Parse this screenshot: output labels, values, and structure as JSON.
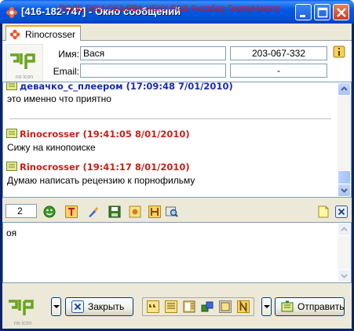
{
  "window": {
    "title": "[416-182-747] - Окно сообщений",
    "title_overlay": "ПОЛЕ ПОИ ОБЪЯВА НЕКУ РОВ Рисабер ТеопмНикогр",
    "icon": "qip-flower-icon",
    "controls": [
      "minimize-icon",
      "maximize-icon",
      "close-icon"
    ]
  },
  "tab": {
    "label": "Rinocrosser",
    "icon": "flower-icon"
  },
  "contact": {
    "name_label": "Имя:",
    "name_value": "Вася",
    "uin_value": "203-067-332",
    "email_label": "Email:",
    "email_value": "",
    "extra_value": "-",
    "logo_caption": "no icon"
  },
  "history": {
    "messages": [
      {
        "author": "девачко_с_плеером",
        "time": "(17:09:48 7/01/2010)",
        "text": "это именно что приятно",
        "color": "#1a2ab0"
      },
      {
        "author": "Rinocrosser",
        "time": "(19:41:05 8/01/2010)",
        "text": "Сижу на кинопоиске",
        "color": "#c8201a"
      },
      {
        "author": "Rinocrosser",
        "time": "(19:41:17 8/01/2010)",
        "text": "Думаю написать рецензию к порнофильму",
        "color": "#c8201a"
      }
    ]
  },
  "format_toolbar": {
    "counter": "2",
    "icons": [
      "smiley-icon",
      "text-format-icon",
      "color-brush-icon",
      "save-icon",
      "image-icon",
      "history-icon",
      "search-icon",
      "note-icon",
      "close-tab-icon"
    ]
  },
  "input": {
    "text": "оя"
  },
  "bottom": {
    "logo_caption": "no icon",
    "close_label": "Закрыть",
    "send_label": "Отправить",
    "strip_icons": [
      "quote-icon",
      "notes-icon",
      "contacts-icon",
      "transfer-icon",
      "paste-icon",
      "n-icon"
    ]
  },
  "colors": {
    "titlebar": "#0058e6",
    "own_nick": "#c8201a",
    "other_nick": "#1a2ab0",
    "qip_green": "#6aa520"
  }
}
